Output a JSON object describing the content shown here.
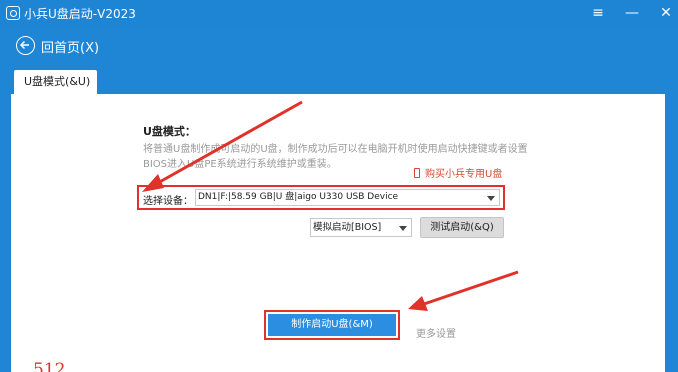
{
  "window": {
    "title": "小兵U盘启动-V2023",
    "menu_icon": "≡",
    "minimize_icon": "—",
    "close_icon": "✕"
  },
  "nav": {
    "back_label": "回首页(X)"
  },
  "tab": {
    "label": "U盘模式(&U)"
  },
  "usb_mode": {
    "title": "U盘模式：",
    "description": "将普通U盘制作成可启动的U盘，制作成功后可以在电脑开机时使用启动快捷键或者设置BIOS进入U盘PE系统进行系统维护或重装。",
    "buy_link": "购买小兵专用U盘",
    "device_label": "选择设备：",
    "device_value": "DN1|F:|58.59 GB|U 盘|aigo U330 USB Device",
    "boot_mode_value": "模拟启动[BIOS]",
    "test_button": "测试启动(&Q)",
    "make_button": "制作启动U盘(&M)",
    "more_settings": "更多设置"
  },
  "annotation": {
    "corner_text": "512"
  },
  "colors": {
    "brand_blue": "#1f86d6",
    "highlight_red": "#e0312a",
    "button_blue": "#2b8ee0"
  }
}
